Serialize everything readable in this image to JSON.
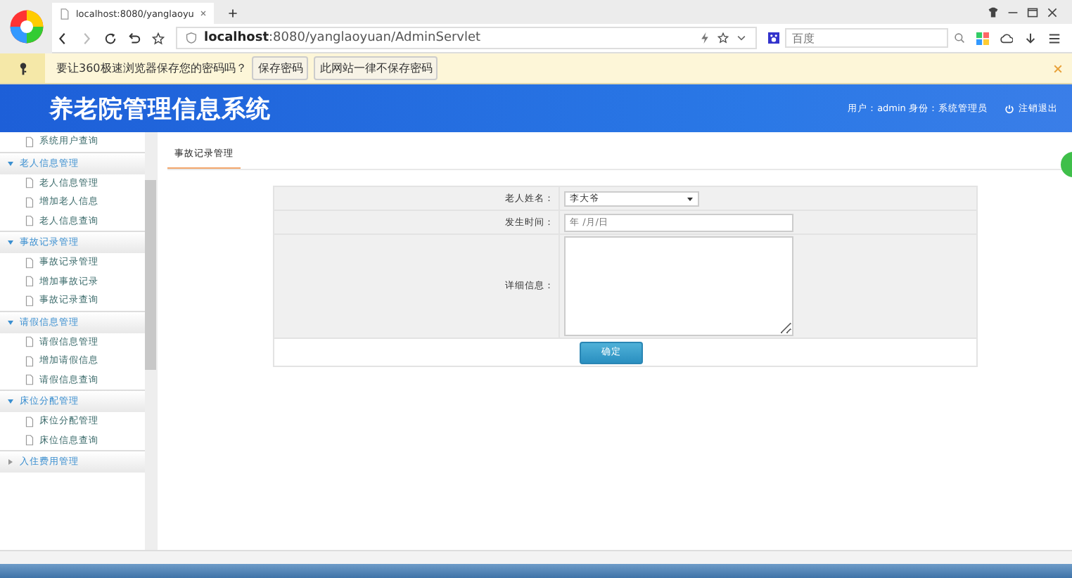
{
  "browser": {
    "tab_title": "localhost:8080/yanglaoyu",
    "url_host": "localhost",
    "url_rest": ":8080/yanglaoyuan/AdminServlet",
    "search_placeholder": "百度"
  },
  "password_bar": {
    "prompt": "要让360极速浏览器保存您的密码吗？",
    "buttons": [
      "保存密码",
      "此网站一律不保存密码"
    ]
  },
  "header": {
    "title": "养老院管理信息系统",
    "user_info": "用户：admin 身份：系统管理员",
    "logout": "注销退出"
  },
  "sidebar": {
    "items": [
      {
        "kind": "item",
        "label": "系统用户查询"
      },
      {
        "kind": "group",
        "label": "老人信息管理",
        "expanded": true
      },
      {
        "kind": "item",
        "label": "老人信息管理"
      },
      {
        "kind": "item",
        "label": "增加老人信息"
      },
      {
        "kind": "item",
        "label": "老人信息查询"
      },
      {
        "kind": "group",
        "label": "事故记录管理",
        "expanded": true
      },
      {
        "kind": "item",
        "label": "事故记录管理"
      },
      {
        "kind": "item",
        "label": "增加事故记录"
      },
      {
        "kind": "item",
        "label": "事故记录查询"
      },
      {
        "kind": "group",
        "label": "请假信息管理",
        "expanded": true
      },
      {
        "kind": "item",
        "label": "请假信息管理"
      },
      {
        "kind": "item",
        "label": "增加请假信息"
      },
      {
        "kind": "item",
        "label": "请假信息查询"
      },
      {
        "kind": "group",
        "label": "床位分配管理",
        "expanded": true
      },
      {
        "kind": "item",
        "label": "床位分配管理"
      },
      {
        "kind": "item",
        "label": "床位信息查询"
      },
      {
        "kind": "group",
        "label": "入住费用管理",
        "expanded": false
      }
    ]
  },
  "page_tabs": [
    {
      "label": "事故记录管理",
      "selected": true
    }
  ],
  "form": {
    "fields": [
      {
        "kind": "select",
        "label": "老人姓名：",
        "value": "李大爷"
      },
      {
        "kind": "date",
        "label": "发生时间：",
        "placeholder": "年 /月/日"
      },
      {
        "kind": "textarea",
        "label": "详细信息："
      }
    ],
    "submit": "确定"
  }
}
